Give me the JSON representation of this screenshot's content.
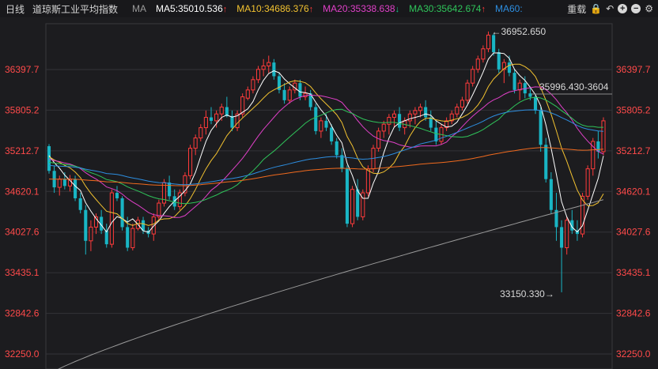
{
  "header": {
    "period": "日线",
    "name": "道琼斯工业平均指数",
    "ma_label": "MA",
    "ma_items": [
      {
        "label": "MA5:35010.536",
        "color": "#ffffff",
        "arrow": "↑",
        "dir": "up"
      },
      {
        "label": "MA10:34686.376",
        "color": "#f2c230",
        "arrow": "↑",
        "dir": "up"
      },
      {
        "label": "MA20:35338.638",
        "color": "#e040c8",
        "arrow": "↓",
        "dir": "down"
      },
      {
        "label": "MA30:35642.674",
        "color": "#2fc45a",
        "arrow": "↑",
        "dir": "up"
      },
      {
        "label": "MA60:",
        "color": "#2d8ee0",
        "arrow": "",
        "dir": "up"
      }
    ],
    "tools": {
      "restore": "重载",
      "lock": "🔒",
      "undo": "↶",
      "zoom_in": "+",
      "zoom_out": "−",
      "settings": "⚙"
    }
  },
  "chart_data": {
    "type": "candlestick",
    "yticks": [
      "36397.7",
      "35805.2",
      "35212.7",
      "34620.1",
      "34027.6",
      "33435.1",
      "32842.6",
      "32250.0"
    ],
    "ylim": [
      32250.0,
      36397.7
    ],
    "high_annotation": "←36952.650",
    "low_annotation": "33150.330→",
    "cursor_value": "35996.430-3604",
    "colors": {
      "up": "#ff3b3b",
      "down": "#19b5c4",
      "ma5": "#ffffff",
      "ma10": "#f2c230",
      "ma20": "#e040c8",
      "ma30": "#2fc45a",
      "ma60": "#2d8ee0",
      "ma120": "#f06a1e",
      "ma250": "#9a9a9a"
    },
    "candles": [
      [
        35280,
        35310,
        34880,
        34920
      ],
      [
        34920,
        35000,
        34600,
        34680
      ],
      [
        34680,
        34850,
        34560,
        34800
      ],
      [
        34800,
        34900,
        34650,
        34700
      ],
      [
        34700,
        34860,
        34620,
        34800
      ],
      [
        34800,
        34850,
        34480,
        34520
      ],
      [
        34520,
        34600,
        34300,
        34350
      ],
      [
        34350,
        34420,
        33700,
        33900
      ],
      [
        33900,
        34200,
        33750,
        34100
      ],
      [
        34100,
        34300,
        34000,
        34250
      ],
      [
        34250,
        34350,
        34000,
        34050
      ],
      [
        34050,
        34150,
        33800,
        33850
      ],
      [
        33850,
        34650,
        33800,
        34600
      ],
      [
        34600,
        34700,
        34480,
        34520
      ],
      [
        34520,
        34550,
        34050,
        34100
      ],
      [
        34100,
        34250,
        33750,
        33800
      ],
      [
        33800,
        34150,
        33760,
        34080
      ],
      [
        34080,
        34250,
        34050,
        34200
      ],
      [
        34200,
        34250,
        34000,
        34050
      ],
      [
        34050,
        34100,
        33950,
        34000
      ],
      [
        34000,
        34300,
        33900,
        34250
      ],
      [
        34250,
        34500,
        34200,
        34450
      ],
      [
        34450,
        34800,
        34400,
        34750
      ],
      [
        34750,
        34850,
        34500,
        34550
      ],
      [
        34550,
        34650,
        34350,
        34400
      ],
      [
        34400,
        34650,
        34350,
        34600
      ],
      [
        34600,
        34900,
        34550,
        34850
      ],
      [
        34850,
        35300,
        34800,
        35250
      ],
      [
        35250,
        35450,
        35150,
        35400
      ],
      [
        35400,
        35600,
        35350,
        35550
      ],
      [
        35550,
        35800,
        35450,
        35700
      ],
      [
        35700,
        35850,
        35600,
        35650
      ],
      [
        35650,
        35800,
        35550,
        35750
      ],
      [
        35750,
        35900,
        35650,
        35850
      ],
      [
        35850,
        36000,
        35700,
        35720
      ],
      [
        35720,
        35800,
        35500,
        35550
      ],
      [
        35550,
        35800,
        35500,
        35750
      ],
      [
        35750,
        36050,
        35700,
        36000
      ],
      [
        35980,
        36150,
        35950,
        36100
      ],
      [
        36100,
        36300,
        36050,
        36250
      ],
      [
        36250,
        36450,
        36200,
        36400
      ],
      [
        36400,
        36550,
        36300,
        36450
      ],
      [
        36450,
        36600,
        36350,
        36500
      ],
      [
        36500,
        36550,
        36250,
        36300
      ],
      [
        36300,
        36350,
        36050,
        36100
      ],
      [
        36100,
        36200,
        35900,
        35950
      ],
      [
        35950,
        36150,
        35900,
        36100
      ],
      [
        36100,
        36250,
        36050,
        36200
      ],
      [
        36200,
        36250,
        35950,
        36000
      ],
      [
        36000,
        36150,
        35950,
        36050
      ],
      [
        36050,
        36100,
        35800,
        35850
      ],
      [
        35850,
        35900,
        35450,
        35500
      ],
      [
        35500,
        35700,
        35400,
        35650
      ],
      [
        35650,
        35750,
        35500,
        35550
      ],
      [
        35550,
        35600,
        35300,
        35350
      ],
      [
        35350,
        35400,
        35100,
        35150
      ],
      [
        35150,
        35250,
        34900,
        34950
      ],
      [
        34950,
        35000,
        34100,
        34150
      ],
      [
        34150,
        34700,
        34100,
        34650
      ],
      [
        34650,
        34800,
        34200,
        34250
      ],
      [
        34250,
        34650,
        34200,
        34600
      ],
      [
        34600,
        35000,
        34550,
        34950
      ],
      [
        34950,
        35300,
        34900,
        35250
      ],
      [
        35250,
        35550,
        35200,
        35500
      ],
      [
        35500,
        35650,
        35400,
        35600
      ],
      [
        35600,
        35750,
        35450,
        35700
      ],
      [
        35700,
        35800,
        35550,
        35750
      ],
      [
        35750,
        35850,
        35500,
        35550
      ],
      [
        35550,
        35700,
        35450,
        35650
      ],
      [
        35650,
        35800,
        35550,
        35750
      ],
      [
        35750,
        35850,
        35600,
        35800
      ],
      [
        35800,
        35900,
        35700,
        35850
      ],
      [
        35850,
        35950,
        35650,
        35700
      ],
      [
        35700,
        35800,
        35500,
        35550
      ],
      [
        35550,
        35650,
        35300,
        35350
      ],
      [
        35350,
        35600,
        35300,
        35550
      ],
      [
        35550,
        35700,
        35500,
        35650
      ],
      [
        35650,
        35800,
        35600,
        35750
      ],
      [
        35750,
        35900,
        35700,
        35850
      ],
      [
        35850,
        36000,
        35800,
        35950
      ],
      [
        35950,
        36250,
        35900,
        36200
      ],
      [
        36200,
        36450,
        36150,
        36400
      ],
      [
        36400,
        36600,
        36350,
        36550
      ],
      [
        36550,
        36750,
        36500,
        36700
      ],
      [
        36700,
        36952,
        36650,
        36900
      ],
      [
        36900,
        36920,
        36600,
        36650
      ],
      [
        36650,
        36700,
        36350,
        36400
      ],
      [
        36400,
        36550,
        36200,
        36500
      ],
      [
        36500,
        36600,
        36300,
        36350
      ],
      [
        36350,
        36400,
        36050,
        36100
      ],
      [
        36100,
        36250,
        35950,
        36200
      ],
      [
        36200,
        36300,
        35980,
        36050
      ],
      [
        36050,
        36150,
        35950,
        36000
      ],
      [
        36000,
        36050,
        35750,
        35800
      ],
      [
        35800,
        35850,
        35200,
        35300
      ],
      [
        35300,
        35400,
        34750,
        34800
      ],
      [
        34800,
        34900,
        34300,
        34350
      ],
      [
        34350,
        34600,
        33900,
        34100
      ],
      [
        34100,
        34200,
        33150,
        33800
      ],
      [
        33800,
        34250,
        33700,
        34200
      ],
      [
        34200,
        34350,
        34000,
        34050
      ],
      [
        34050,
        34200,
        33900,
        34000
      ],
      [
        34000,
        34600,
        33950,
        34550
      ],
      [
        34550,
        35000,
        34500,
        34950
      ],
      [
        34950,
        35400,
        34850,
        35350
      ],
      [
        35350,
        35500,
        35100,
        35200
      ],
      [
        35200,
        35700,
        35150,
        35650
      ]
    ]
  }
}
